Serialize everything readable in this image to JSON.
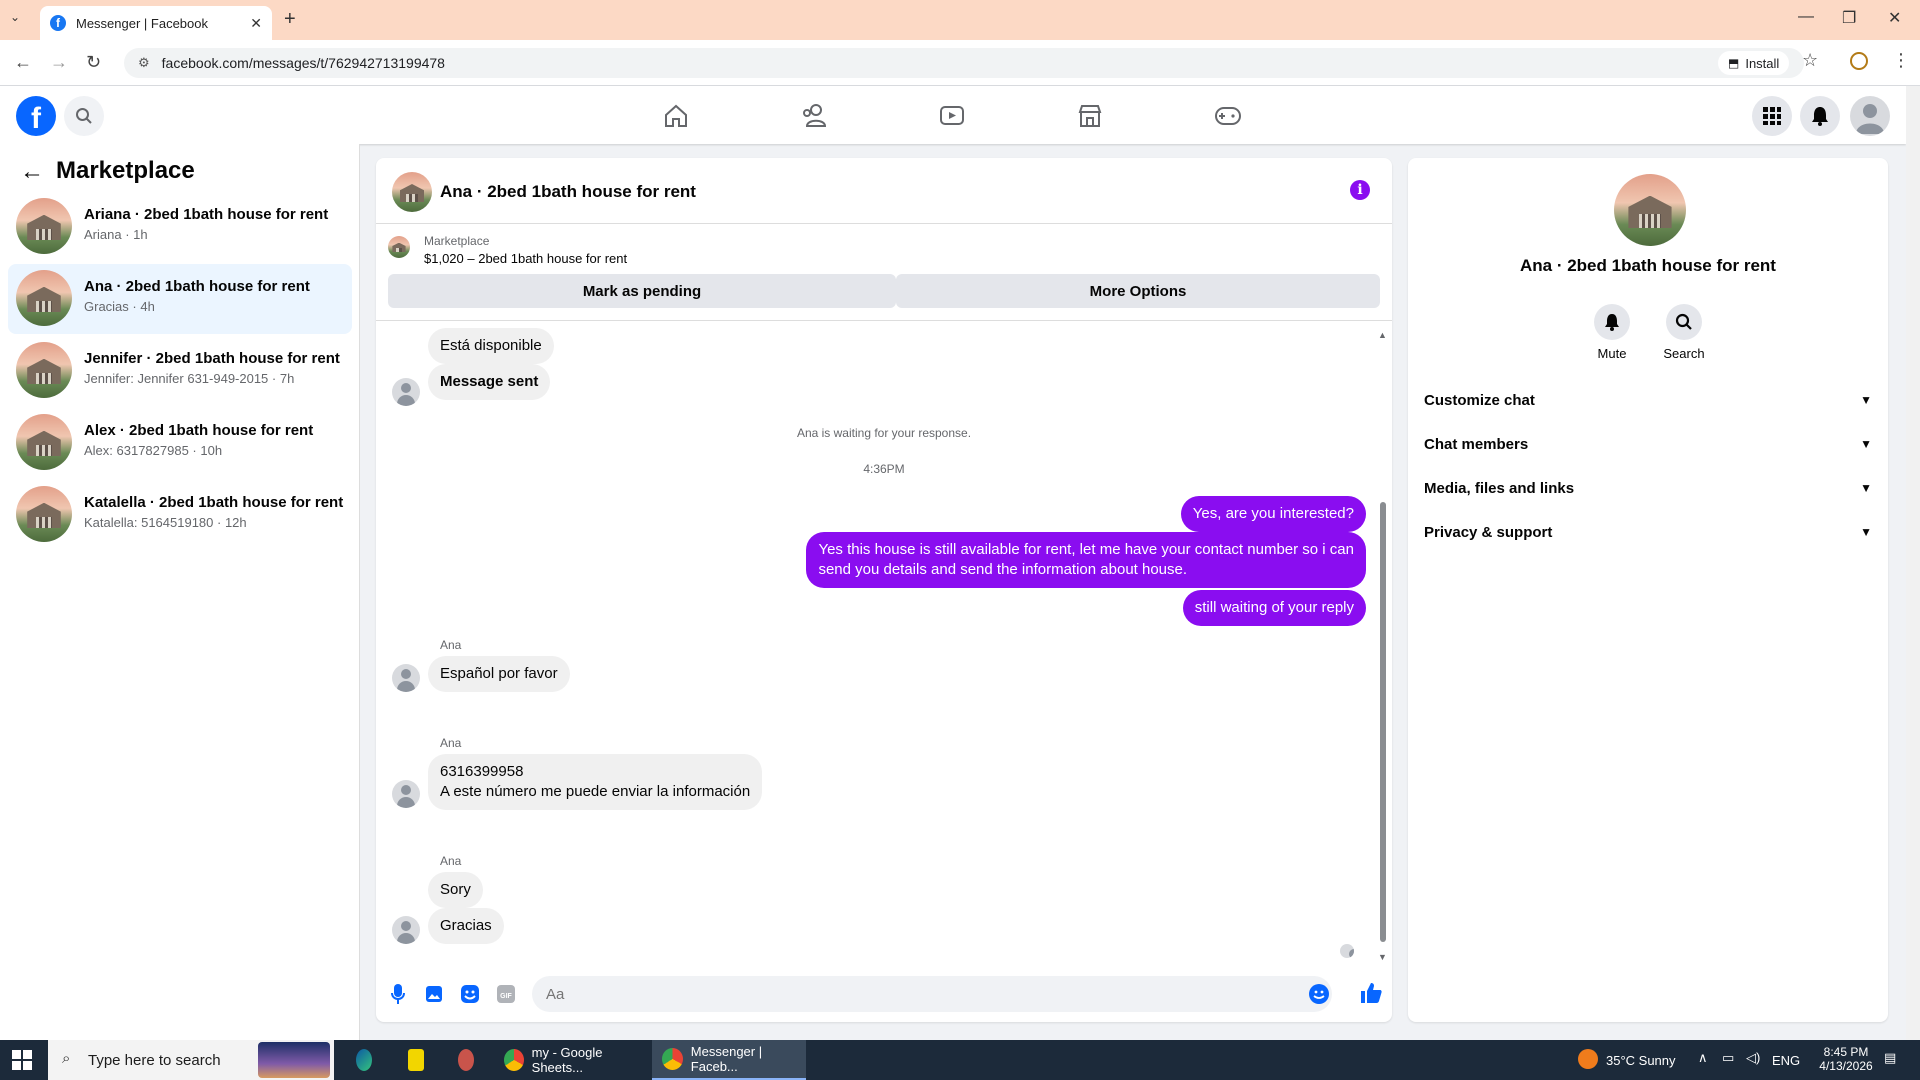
{
  "browser": {
    "tab_title": "Messenger | Facebook",
    "url": "facebook.com/messages/t/762942713199478",
    "install_label": "Install"
  },
  "sidebar": {
    "title": "Marketplace",
    "conversations": [
      {
        "name": "Ariana · 2bed 1bath house for rent",
        "snippet": "Ariana · 1h",
        "active": false
      },
      {
        "name": "Ana · 2bed 1bath house for rent",
        "snippet": "Gracias · 4h",
        "active": true
      },
      {
        "name": "Jennifer · 2bed 1bath house for rent",
        "snippet": "Jennifer: Jennifer 631-949-2015 · 7h",
        "active": false
      },
      {
        "name": "Alex · 2bed 1bath house for rent",
        "snippet": "Alex: 6317827985 · 10h",
        "active": false
      },
      {
        "name": "Katalella · 2bed 1bath house for rent",
        "snippet": "Katalella: 5164519180 · 12h",
        "active": false
      }
    ]
  },
  "chat": {
    "title": "Ana · 2bed 1bath house for rent",
    "banner_label": "Marketplace",
    "banner_price": "$1,020 – 2bed 1bath house for rent",
    "mark_pending_label": "Mark as pending",
    "more_options_label": "More Options",
    "messages": {
      "m1": "Está disponible",
      "m2": "Message sent",
      "waiting": "Ana is waiting for your response.",
      "time": "4:36PM",
      "me1": "Yes, are you interested?",
      "me2_line1": "Yes this house is still available for rent, let me have your contact number so i can",
      "me2_line2": "send you details and send the information about house.",
      "me3": "still waiting of your reply",
      "sender": "Ana",
      "a1": "Español por favor",
      "a2_line1": "6316399958",
      "a2_line2": "A este número me puede enviar la información",
      "a3": "Sory",
      "a4": "Gracias"
    },
    "input_placeholder": "Aa"
  },
  "info_panel": {
    "title": "Ana · 2bed 1bath house for rent",
    "mute_label": "Mute",
    "search_label": "Search",
    "sections": [
      "Customize chat",
      "Chat members",
      "Media, files and links",
      "Privacy & support"
    ]
  },
  "taskbar": {
    "search_placeholder": "Type here to search",
    "app1": "my - Google Sheets...",
    "app2": "Messenger | Faceb...",
    "weather": "35°C  Sunny",
    "lang": "ENG",
    "time": "8:45 PM",
    "date": "4/13/2026"
  },
  "colors": {
    "accent": "#8a0df0",
    "fb_blue": "#0866ff",
    "active_conv_bg": "#ebf5ff",
    "chrome_tab_bar": "#fcd9c5"
  }
}
